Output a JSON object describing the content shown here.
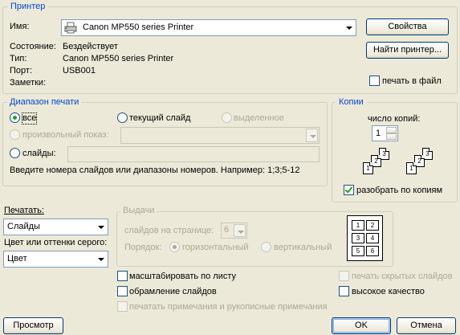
{
  "printer": {
    "legend": "Принтер",
    "name_label": "Имя:",
    "name_value": "Canon MP550 series Printer",
    "state_label": "Состояние:",
    "state_value": "Бездействует",
    "type_label": "Тип:",
    "type_value": "Canon MP550 series Printer",
    "port_label": "Порт:",
    "port_value": "USB001",
    "notes_label": "Заметки:",
    "properties_button": "Свойства",
    "find_button": "Найти принтер...",
    "print_to_file": "печать в файл"
  },
  "range": {
    "legend": "Диапазон печати",
    "all": "все",
    "current_slide": "текущий слайд",
    "selection": "выделенное",
    "custom_show": "произвольный показ:",
    "slides": "слайды:",
    "hint": "Введите номера слайдов или диапазоны номеров. Например: 1;3;5-12"
  },
  "copies": {
    "legend": "Копии",
    "count_label": "число копий:",
    "count_value": "1",
    "collate": "разобрать по копиям",
    "collate_checked": true,
    "stack_a": [
      "1",
      "2",
      "3"
    ],
    "stack_b": [
      "1",
      "2",
      "3"
    ]
  },
  "print_what": {
    "label": "Печатать:",
    "value": "Слайды",
    "color_label": "Цвет или оттенки серого:",
    "color_value": "Цвет"
  },
  "handouts": {
    "legend": "Выдачи",
    "per_page_label": "слайдов на странице:",
    "per_page_value": "6",
    "order_label": "Порядок:",
    "horizontal": "горизонтальный",
    "vertical": "вертикальный",
    "preview_slots": [
      "1",
      "2",
      "3",
      "4",
      "5",
      "6"
    ]
  },
  "options": {
    "scale_to_fit": "масштабировать по листу",
    "frame_slides": "обрамление слайдов",
    "print_comments": "печатать примечания и рукописные примечания",
    "hidden_slides": "печать скрытых слайдов",
    "high_quality": "высокое качество"
  },
  "buttons": {
    "preview": "Просмотр",
    "ok": "OK",
    "cancel": "Отмена"
  }
}
